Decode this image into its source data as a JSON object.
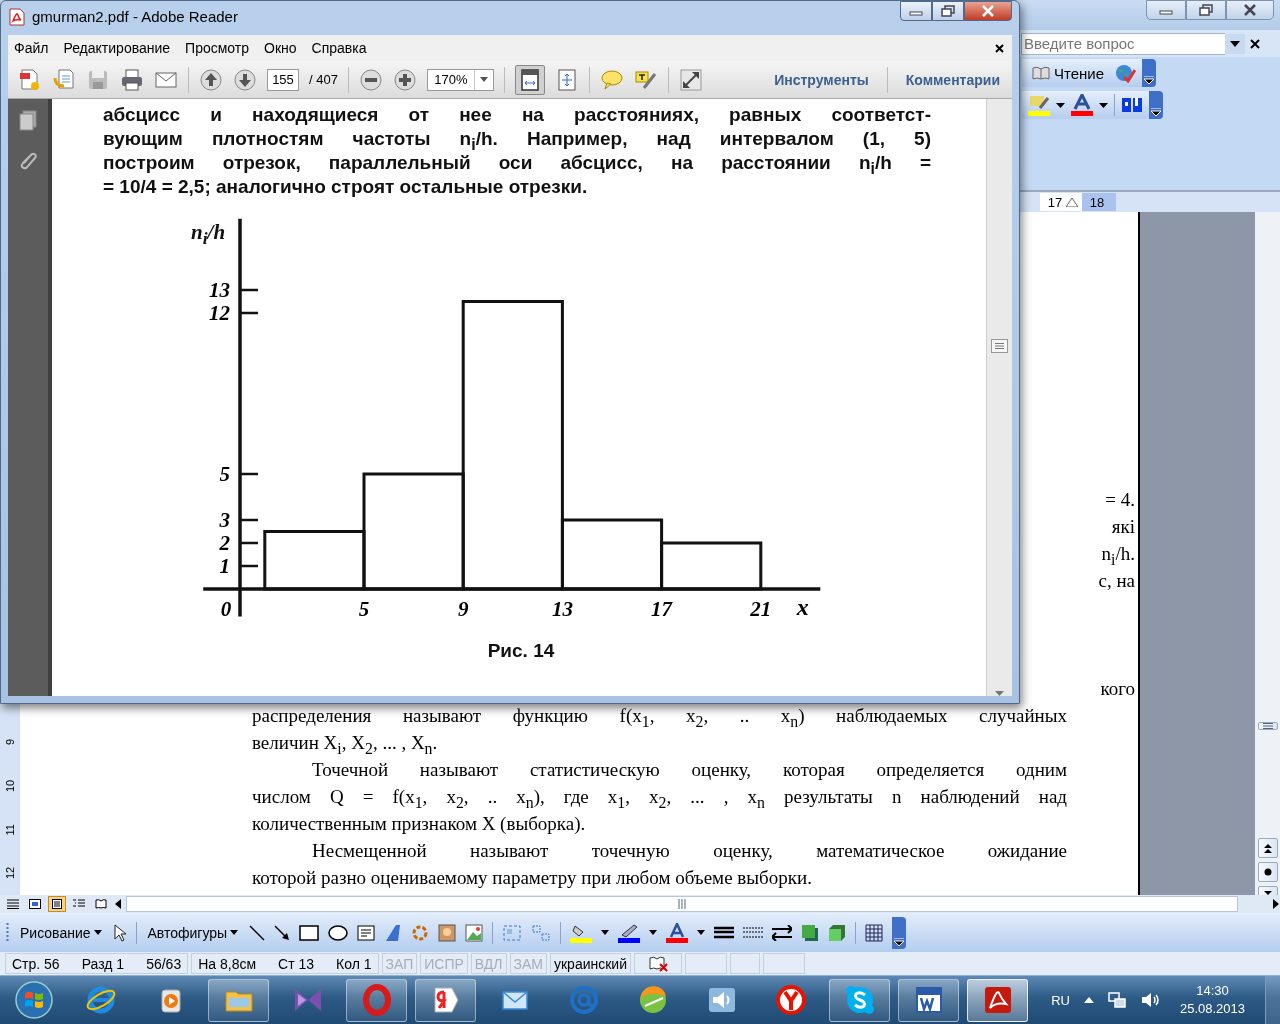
{
  "word_window": {
    "help_field": {
      "placeholder": "Введите вопрос"
    },
    "reading_button": "Чтение",
    "ruler_marks": [
      "17",
      "18"
    ],
    "vertical_ruler_marks": [
      "9",
      "10",
      "11",
      "12"
    ],
    "upper_fragments": [
      "= 4.",
      "які",
      "n$_{i}$/h.",
      "с, на"
    ],
    "lower_lines": [
      {
        "kind": "fragment",
        "text": "кого"
      },
      {
        "kind": "line",
        "text": "распределения называют функцию f(x$_{1}$, x$_{2}$, .. x$_{n}$) наблюдаемых случайных"
      },
      {
        "kind": "end",
        "text": "величин X$_{i}$, X$_{2}$, ... , X$_{n}$."
      },
      {
        "kind": "first",
        "text": "Точечной называют статистическую оценку, которая определяется одним"
      },
      {
        "kind": "line",
        "text": "числом Q =  f(x$_{1}$, x$_{2}$, .. x$_{n}$), где x$_{1}$, x$_{2}$, ... , x$_{n}$ результаты n наблюдений над"
      },
      {
        "kind": "end",
        "text": "количественным признаком X (выборка)."
      },
      {
        "kind": "first",
        "text": "Несмещенной называют точечную оценку, математическое ожидание"
      },
      {
        "kind": "end",
        "text": "которой разно оцениваемому параметру при любом объеме выборки."
      }
    ],
    "drawing_toolbar": {
      "draw_menu": "Рисование",
      "autoshapes_menu": "Автофигуры"
    },
    "status_bar": {
      "groups": [
        [
          "Стр. 56",
          "Разд 1",
          "56/63"
        ],
        [
          "На 8,8см",
          "Ст 13",
          "Кол 1"
        ]
      ],
      "modes": [
        {
          "label": "ЗАП",
          "disabled": true
        },
        {
          "label": "ИСПР",
          "disabled": true
        },
        {
          "label": "ВДЛ",
          "disabled": true
        },
        {
          "label": "ЗАМ",
          "disabled": true
        }
      ],
      "language": "украинский"
    }
  },
  "pdf_window": {
    "title": "gmurman2.pdf - Adobe Reader",
    "menu": [
      "Файл",
      "Редактирование",
      "Просмотр",
      "Окно",
      "Справка"
    ],
    "toolbar": {
      "page": "155",
      "page_count": "/ 407",
      "zoom": "170%",
      "tools": "Инструменты",
      "comments": "Комментарии"
    },
    "page": {
      "lines": [
        "абсцисс и находящиеся от нее на расстояниях, равных соответст-",
        "вующим плотностям частоты n$_{i}$/h. Например, над интервалом (1, 5)",
        "построим отрезок, параллельный оси абсцисс, на расстоянии n$_{i}$/h =",
        "= 10/4 = 2,5; аналогично строят остальные отрезки."
      ],
      "figure": {
        "chart_data": {
          "type": "bar",
          "xlabel": "x",
          "ylabel": "n$_{i}$/h",
          "x": [
            3,
            7,
            11,
            15,
            19
          ],
          "values": [
            2.5,
            5,
            12.5,
            3,
            2
          ],
          "xlim": [
            -1.16,
            23.4
          ],
          "ylim": [
            -1.2,
            16.1
          ],
          "xticks": [
            0,
            5,
            9,
            13,
            17,
            21
          ],
          "yticks": [
            1,
            2,
            3,
            5,
            12,
            13
          ]
        },
        "caption": "Рис. 14"
      }
    }
  },
  "taskbar": {
    "apps": [
      {
        "kind": "ie",
        "running": false,
        "selected": false
      },
      {
        "kind": "media",
        "running": false,
        "selected": false
      },
      {
        "kind": "explorer",
        "running": true,
        "selected": false
      },
      {
        "kind": "studio",
        "running": false,
        "selected": false
      },
      {
        "kind": "opera",
        "running": true,
        "selected": false
      },
      {
        "kind": "yandex",
        "running": true,
        "selected": false
      },
      {
        "kind": "mail",
        "running": false,
        "selected": false
      },
      {
        "kind": "at",
        "running": false,
        "selected": false
      },
      {
        "kind": "chart",
        "running": false,
        "selected": false
      },
      {
        "kind": "audio",
        "running": false,
        "selected": false
      },
      {
        "kind": "browser",
        "running": false,
        "selected": false
      },
      {
        "kind": "skype",
        "running": true,
        "selected": false
      },
      {
        "kind": "word",
        "running": true,
        "selected": false
      },
      {
        "kind": "acrobat",
        "running": true,
        "selected": true
      }
    ],
    "language": "RU",
    "time": "14:30",
    "date": "25.08.2013"
  }
}
